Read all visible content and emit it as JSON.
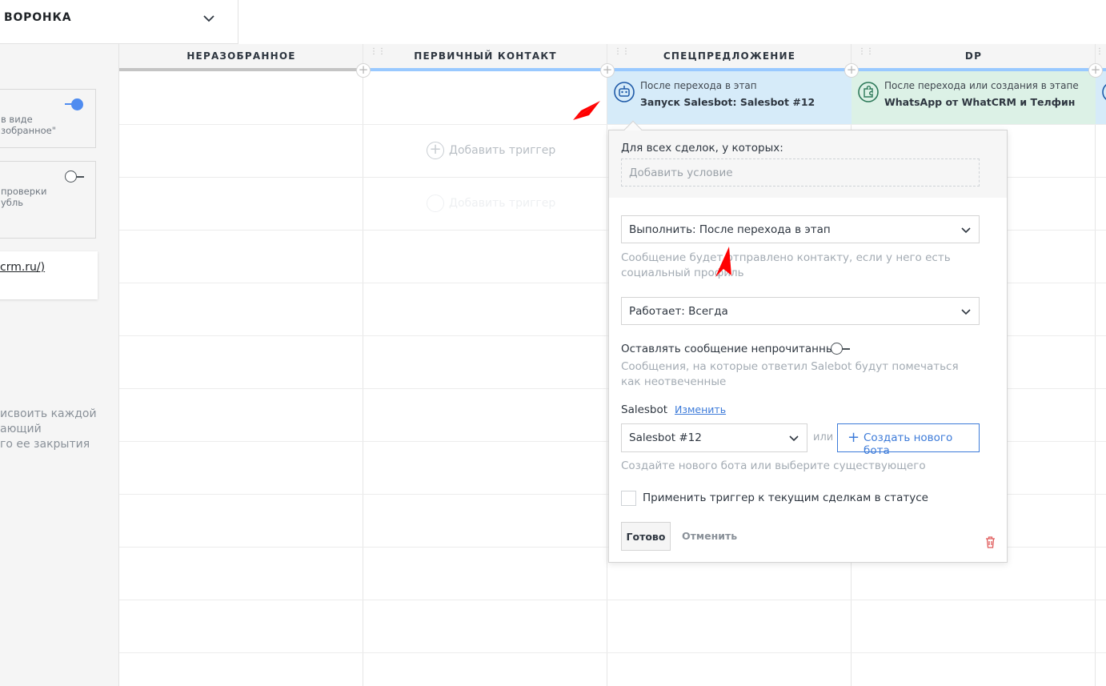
{
  "pipeline": {
    "title": "ВОРОНКА"
  },
  "left": {
    "card1_text": "в виде\nзобранное\"",
    "card2_text": "проверки\nубль",
    "link_text": "crm.ru/)",
    "desc": "исвоить каждой\nающий\nго ее закрытия"
  },
  "columns": [
    {
      "label": "НЕРАЗОБРАННОЕ",
      "color": "#c4c4c4"
    },
    {
      "label": "ПЕРВИЧНЫЙ КОНТАКТ",
      "color": "#99c9ff"
    },
    {
      "label": "СПЕЦПРЕДЛОЖЕНИЕ",
      "color": "#99c9ff"
    },
    {
      "label": "DP",
      "color": "#99c9ff"
    }
  ],
  "triggers": [
    {
      "line1": "После перехода в этап",
      "line2": "Запуск Salesbot: Salesbot #12",
      "icon": "robot-icon",
      "bg": "#d6ebf9"
    },
    {
      "line1": "После перехода или создания в этапе",
      "line2": "WhatsApp от WhatCRM и Телфин",
      "icon": "puzzle-icon",
      "bg": "#dcf1e6"
    }
  ],
  "add_trigger": "Добавить триггер",
  "popup": {
    "condition_label": "Для всех сделок, у которых:",
    "add_condition": "Добавить условие",
    "execute_value": "Выполнить: После перехода в этап",
    "execute_note": "Сообщение будет отправлено контакту, если у него есть социальный профиль",
    "works_value": "Работает: Всегда",
    "unread_label": "Оставлять сообщение непрочитанным",
    "unread_note": "Сообщения, на которые ответил Salebot будут помечаться как неотвеченные",
    "salesbot_label": "Salesbot",
    "change_link": "Изменить",
    "bot_value": "Salesbot #12",
    "or_label": "или",
    "create_bot": "Создать нового бота",
    "bot_note": "Создайте нового бота или выберите существующего",
    "apply_label": "Применить триггер к текущим сделкам в статусе",
    "done": "Готово",
    "cancel": "Отменить"
  },
  "colors": {
    "accent": "#3d7bd9",
    "toggle_on": "#4f8cf0",
    "arrow": "#ff0000",
    "delete": "#e05a5a"
  }
}
